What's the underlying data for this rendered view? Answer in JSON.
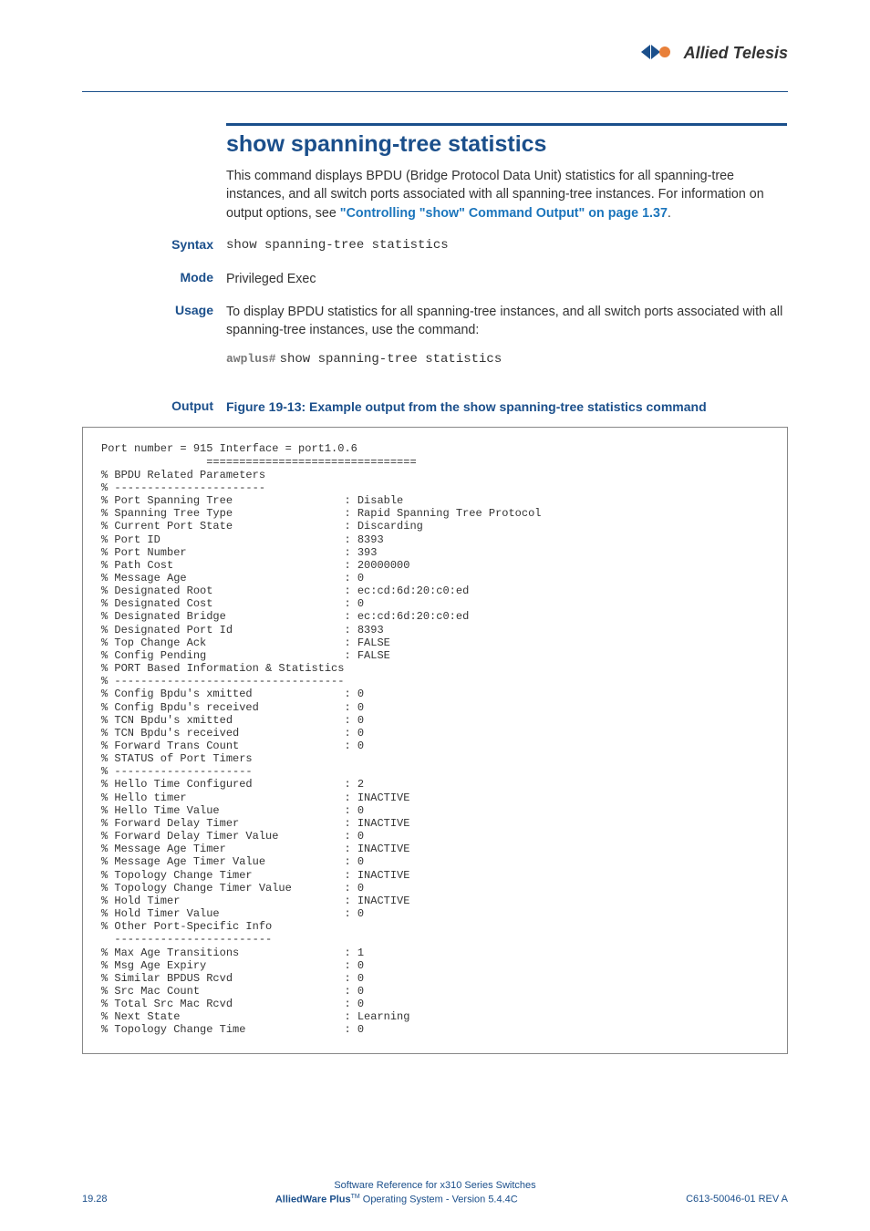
{
  "brand": "Allied Telesis",
  "title": "show spanning-tree statistics",
  "intro_text": "This command displays BPDU (Bridge Protocol Data Unit) statistics for all spanning-tree instances, and all switch ports associated with all spanning-tree instances. For information on output options, see ",
  "intro_link": "\"Controlling \"show\" Command Output\" on page 1.37",
  "intro_suffix": ".",
  "syntax_label": "Syntax",
  "syntax_value": "show spanning-tree statistics",
  "mode_label": "Mode",
  "mode_value": "Privileged Exec",
  "usage_label": "Usage",
  "usage_text": "To display BPDU statistics for all spanning-tree instances, and all switch ports associated with all spanning-tree instances, use the command:",
  "usage_prompt": "awplus#",
  "usage_command": "show spanning-tree statistics",
  "output_label": "Output",
  "figure_caption": "Figure 19-13: Example output from the show spanning-tree statistics command",
  "terminal_output": "Port number = 915 Interface = port1.0.6\n                ================================\n% BPDU Related Parameters\n% -----------------------\n% Port Spanning Tree                 : Disable\n% Spanning Tree Type                 : Rapid Spanning Tree Protocol\n% Current Port State                 : Discarding\n% Port ID                            : 8393\n% Port Number                        : 393\n% Path Cost                          : 20000000\n% Message Age                        : 0\n% Designated Root                    : ec:cd:6d:20:c0:ed\n% Designated Cost                    : 0\n% Designated Bridge                  : ec:cd:6d:20:c0:ed\n% Designated Port Id                 : 8393\n% Top Change Ack                     : FALSE\n% Config Pending                     : FALSE\n% PORT Based Information & Statistics\n% -----------------------------------\n% Config Bpdu's xmitted              : 0\n% Config Bpdu's received             : 0\n% TCN Bpdu's xmitted                 : 0\n% TCN Bpdu's received                : 0\n% Forward Trans Count                : 0\n% STATUS of Port Timers\n% ---------------------\n% Hello Time Configured              : 2\n% Hello timer                        : INACTIVE\n% Hello Time Value                   : 0\n% Forward Delay Timer                : INACTIVE\n% Forward Delay Timer Value          : 0\n% Message Age Timer                  : INACTIVE\n% Message Age Timer Value            : 0\n% Topology Change Timer              : INACTIVE\n% Topology Change Timer Value        : 0\n% Hold Timer                         : INACTIVE\n% Hold Timer Value                   : 0\n% Other Port-Specific Info\n  ------------------------\n% Max Age Transitions                : 1\n% Msg Age Expiry                     : 0\n% Similar BPDUS Rcvd                 : 0\n% Src Mac Count                      : 0\n% Total Src Mac Rcvd                 : 0\n% Next State                         : Learning\n% Topology Change Time               : 0",
  "footer": {
    "line1": "Software Reference for x310 Series Switches",
    "left": "19.28",
    "center_prefix": "AlliedWare Plus",
    "center_tm": "TM",
    "center_suffix": " Operating System  - Version 5.4.4C",
    "right": "C613-50046-01 REV A"
  }
}
